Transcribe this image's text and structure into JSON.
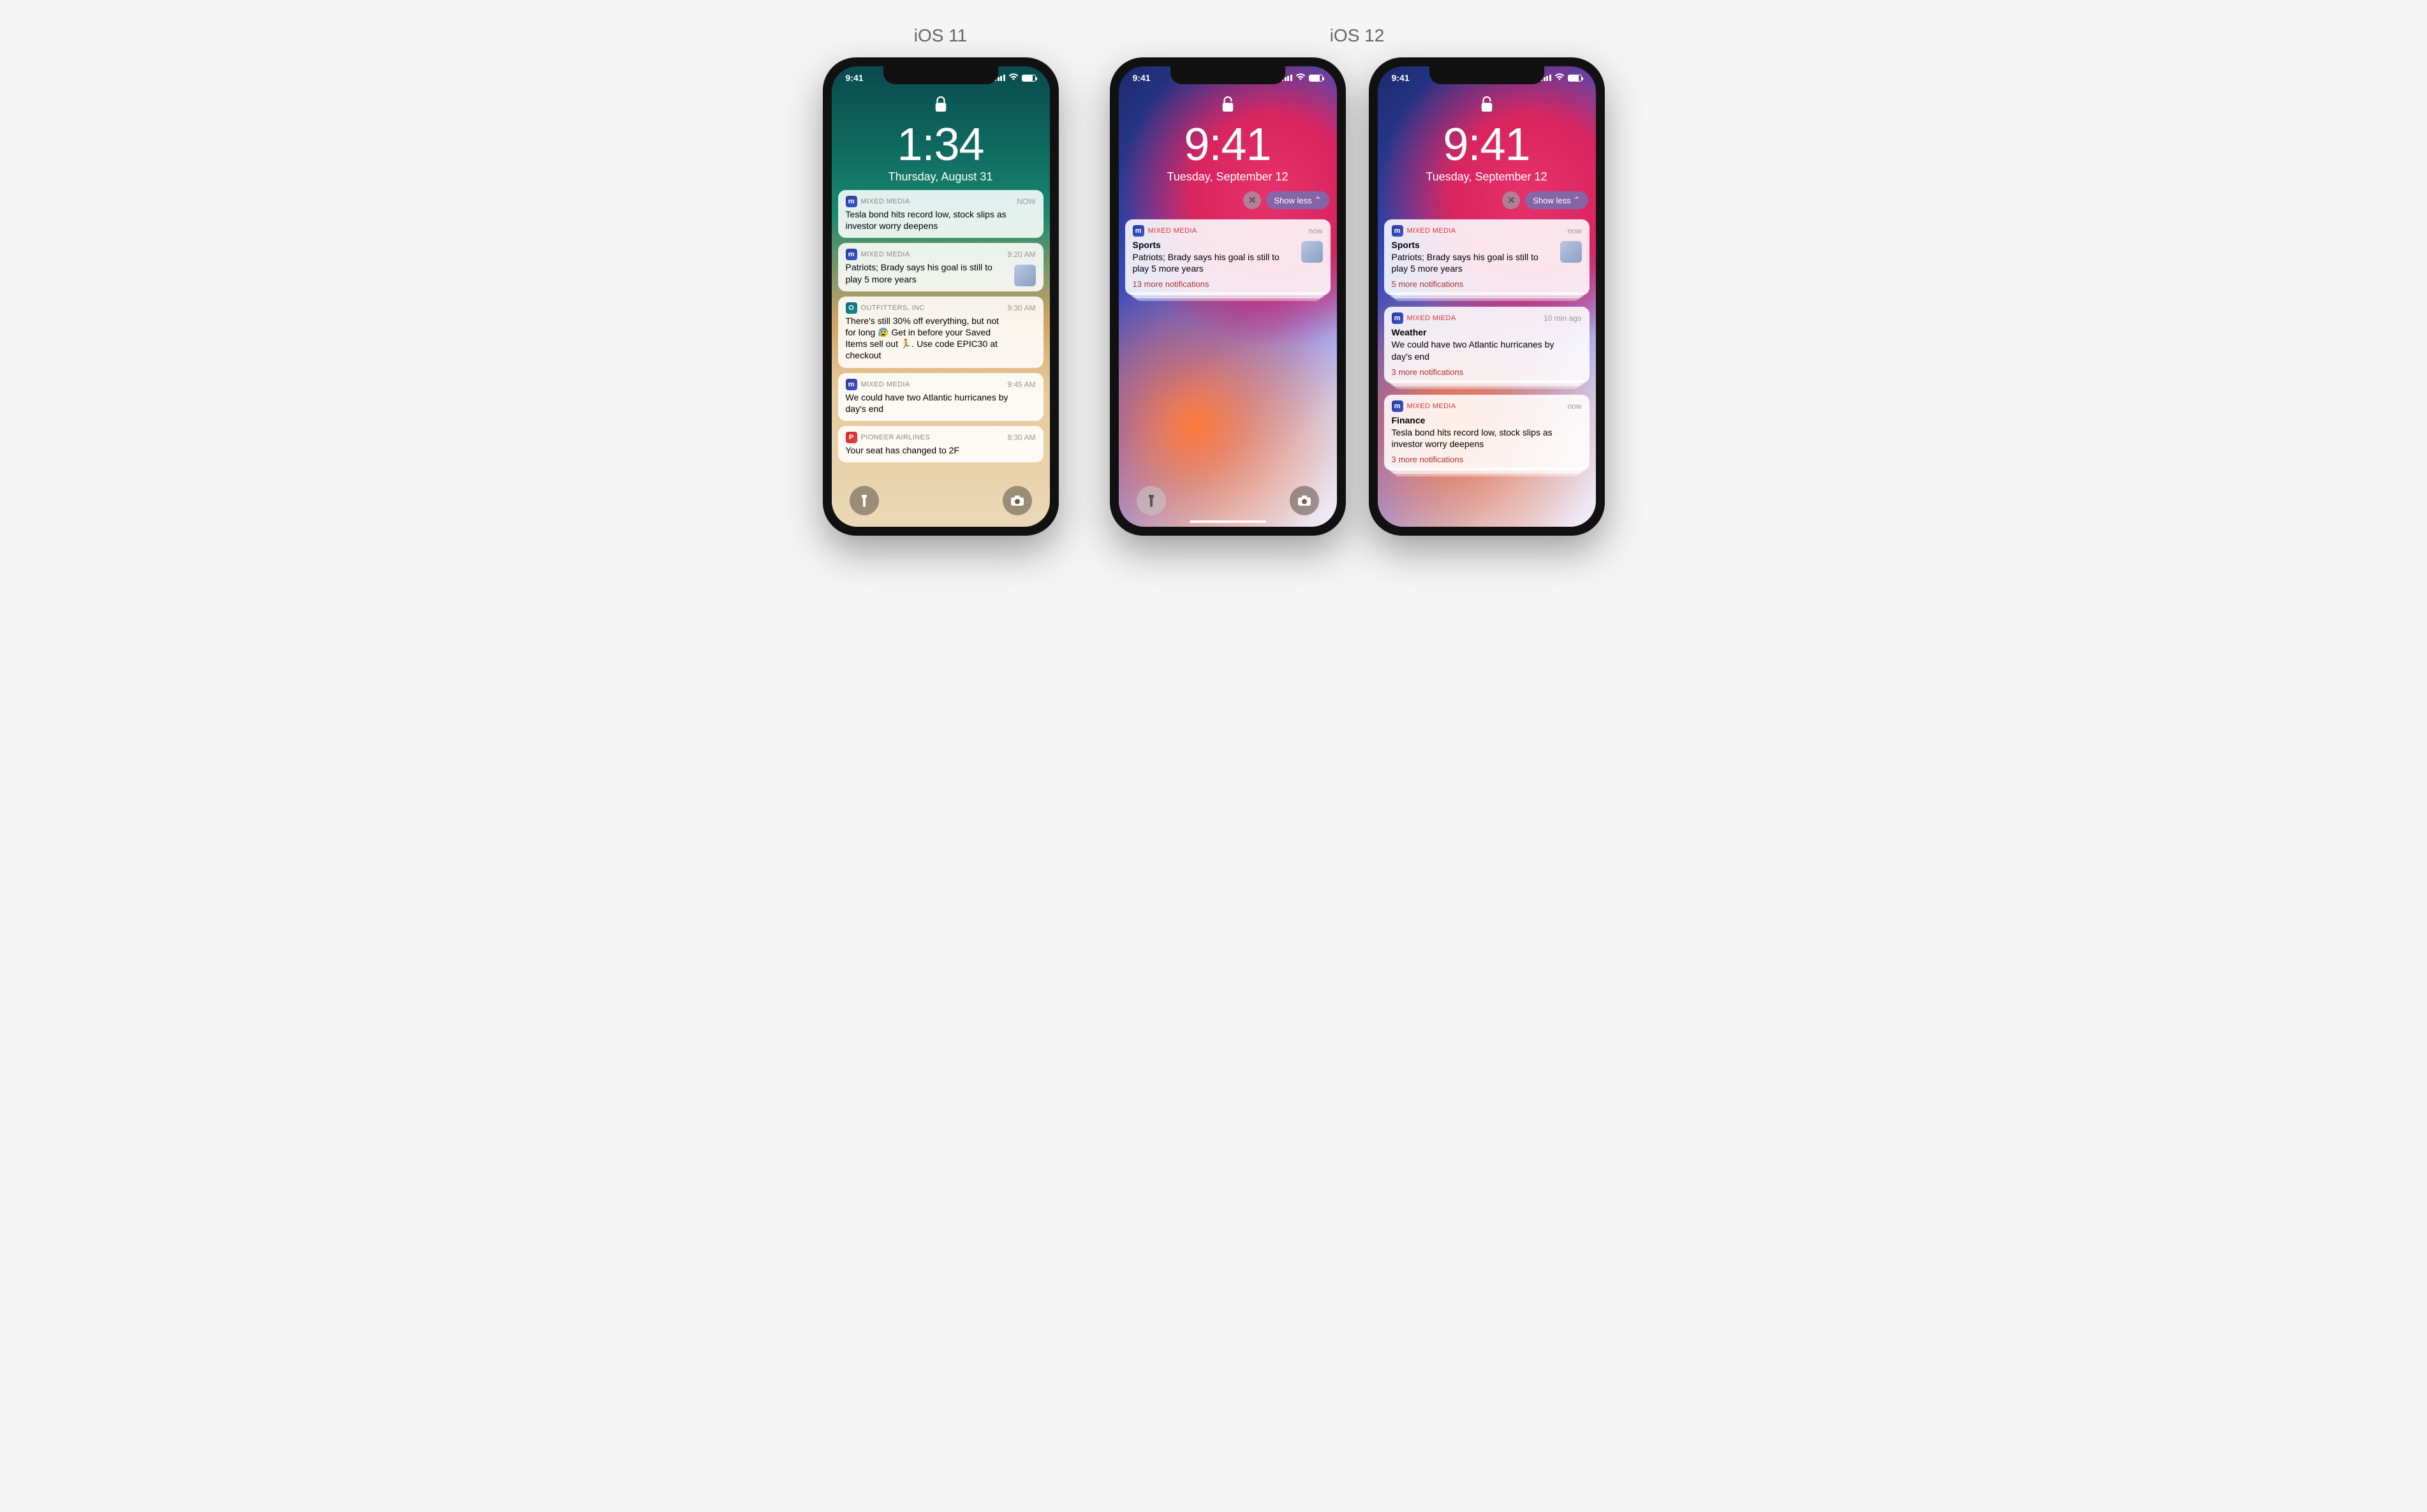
{
  "labels": {
    "ios11": "iOS 11",
    "ios12": "iOS 12",
    "show_less": "Show less"
  },
  "icon_glyph": {
    "m": "m",
    "p": "P",
    "o": "O"
  },
  "phone1": {
    "status_time": "9:41",
    "locked": true,
    "time": "1:34",
    "date": "Thursday, August 31",
    "notifications": [
      {
        "app": "MIXED MEDIA",
        "icon": "m",
        "when": "NOW",
        "body": "Tesla bond hits record low, stock slips as investor worry deepens"
      },
      {
        "app": "MIXED MEDIA",
        "icon": "m",
        "when": "9:20 AM",
        "body": "Patriots; Brady says his goal is still to play 5 more years",
        "thumb": true
      },
      {
        "app": "OUTFITTERS, INC",
        "icon": "o",
        "icon_style": "teal",
        "when": "9:30 AM",
        "body": "There's still 30% off everything, but not for long 😰 Get in before your Saved Items sell out 🏃. Use code EPIC30 at checkout"
      },
      {
        "app": "MIXED MEDIA",
        "icon": "m",
        "when": "9:45 AM",
        "body": "We could have two Atlantic hurricanes by day's end"
      },
      {
        "app": "PIONEER AIRLINES",
        "icon": "p",
        "icon_style": "red",
        "when": "8:30 AM",
        "body": "Your seat has changed to 2F"
      }
    ]
  },
  "phone2": {
    "status_time": "9:41",
    "locked": false,
    "time": "9:41",
    "date": "Tuesday, September 12",
    "show_chips": true,
    "notifications": [
      {
        "app": "MIXED MEDIA",
        "icon": "m",
        "accent": true,
        "when": "now",
        "title": "Sports",
        "body": "Patriots; Brady says his goal is still to play 5 more years",
        "thumb": true,
        "more": "13 more notifications",
        "stacked": true
      }
    ]
  },
  "phone3": {
    "status_time": "9:41",
    "locked": false,
    "time": "9:41",
    "date": "Tuesday, September 12",
    "show_chips": true,
    "notifications": [
      {
        "app": "MIXED MEDIA",
        "icon": "m",
        "accent": true,
        "when": "now",
        "title": "Sports",
        "body": "Patriots; Brady says his goal is still to play 5 more years",
        "thumb": true,
        "more": "5 more notifications",
        "stacked": true
      },
      {
        "app": "MIXED MIEDA",
        "icon": "m",
        "accent": true,
        "when": "10 min ago",
        "title": "Weather",
        "body": "We could have two Atlantic hurricanes by day's end",
        "more": "3 more notifications",
        "stacked": true
      },
      {
        "app": "MIXED MEDIA",
        "icon": "m",
        "accent": true,
        "when": "now",
        "title": "Finance",
        "body": "Tesla bond hits record low, stock slips as investor worry deepens",
        "more": "3 more notifications",
        "stacked": true
      }
    ]
  }
}
